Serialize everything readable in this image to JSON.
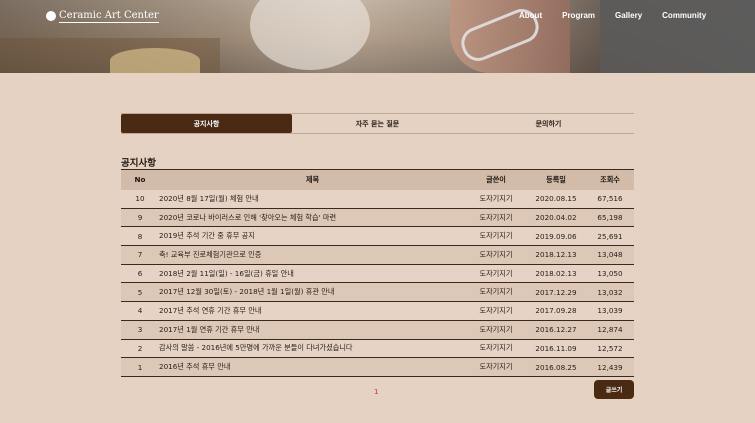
{
  "site": {
    "name": "Ceramic Art Center"
  },
  "nav": {
    "items": [
      "About",
      "Program",
      "Gallery",
      "Community"
    ]
  },
  "tabs": [
    "공지사항",
    "자주 묻는 질문",
    "문의하기"
  ],
  "section_title": "공지사항",
  "table": {
    "headers": [
      "No",
      "제목",
      "글쓴이",
      "등록일",
      "조회수"
    ],
    "rows": [
      [
        "10",
        "2020년 8월 17일(월) 체험 안내",
        "도자기지기",
        "2020.08.15",
        "67,516"
      ],
      [
        "9",
        "2020년 코로나 바이러스로 인해 '찾아오는 체험 학습' 마련",
        "도자기지기",
        "2020.04.02",
        "65,198"
      ],
      [
        "8",
        "2019년 추석 기간 중 휴무 공지",
        "도자기지기",
        "2019.09.06",
        "25,691"
      ],
      [
        "7",
        "축! 교육부 진로체험기관으로 인증",
        "도자기지기",
        "2018.12.13",
        "13,048"
      ],
      [
        "6",
        "2018년 2월 11일(일) - 16일(금) 휴일 안내",
        "도자기지기",
        "2018.02.13",
        "13,050"
      ],
      [
        "5",
        "2017년 12월 30일(토) - 2018년 1월 1일(월) 휴관 안내",
        "도자기지기",
        "2017.12.29",
        "13,032"
      ],
      [
        "4",
        "2017년 추석 연휴 기간 휴무 안내",
        "도자기지기",
        "2017.09.28",
        "13,039"
      ],
      [
        "3",
        "2017년 1월 연휴 기간 휴무 안내",
        "도자기지기",
        "2016.12.27",
        "12,874"
      ],
      [
        "2",
        "감사의 말씀 - 2016년에 5만명에 가까운 분들이 다녀가셨습니다",
        "도자기지기",
        "2016.11.09",
        "12,572"
      ],
      [
        "1",
        "2016년 추석 휴무 안내",
        "도자기지기",
        "2016.08.25",
        "12,439"
      ]
    ]
  },
  "pagination": {
    "current": "1"
  },
  "write_button": "글쓰기"
}
